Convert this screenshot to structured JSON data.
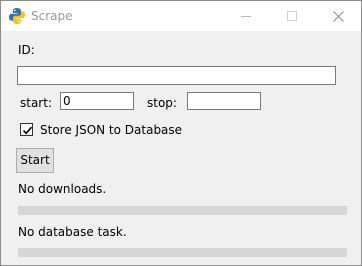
{
  "window": {
    "title": "Scrape",
    "icon": "python-icon",
    "controls": [
      "minimize-icon",
      "maximize-icon",
      "close-icon"
    ]
  },
  "form": {
    "id_label": "ID:",
    "id_value": "",
    "start_label": "start:",
    "start_value": "0",
    "stop_label": "stop:",
    "stop_value": "",
    "store_json_label": "Store JSON to Database",
    "store_json_checked": true,
    "start_button_label": "Start"
  },
  "status": {
    "download_text": "No downloads.",
    "download_progress": 0,
    "database_text": "No database task.",
    "database_progress": 0
  }
}
